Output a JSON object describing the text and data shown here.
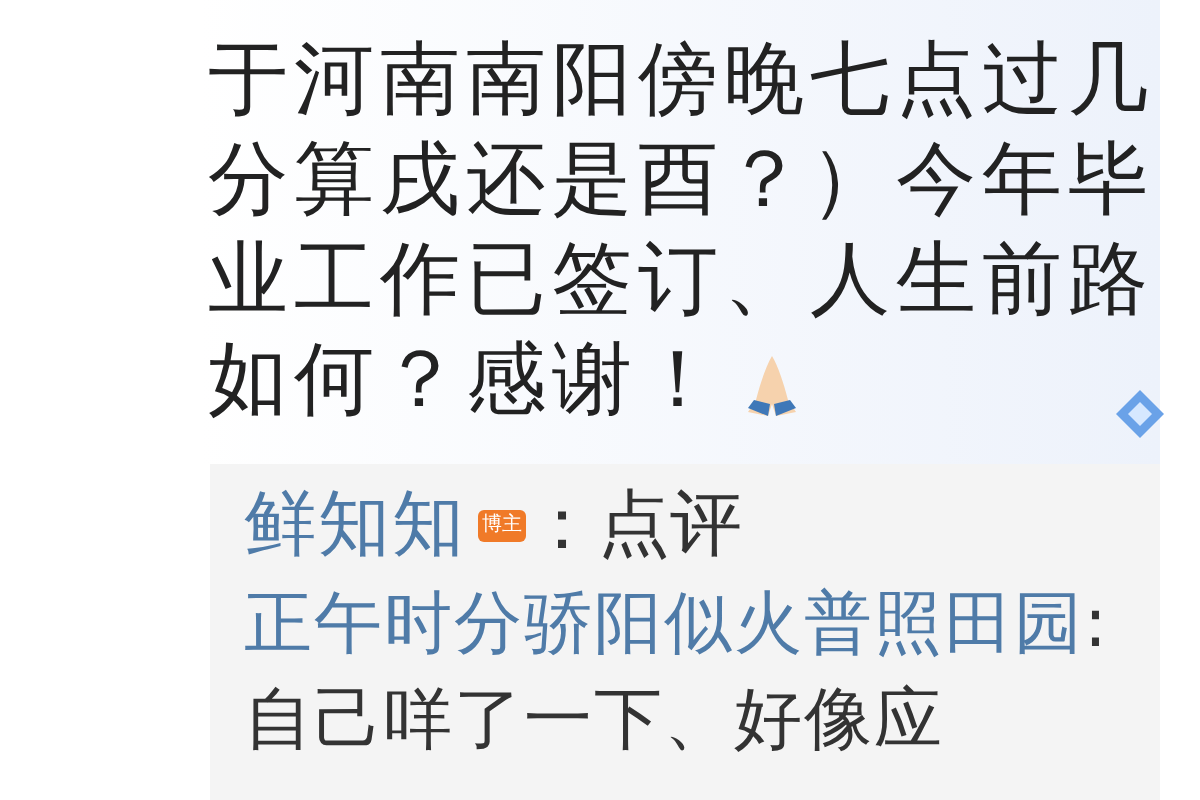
{
  "post": {
    "lines": [
      "于河南南阳傍晚七点过几",
      "分算戌还是酉？）今年毕",
      "业工作已签订、人生前路",
      "如何？感谢！"
    ]
  },
  "comment": {
    "author": "鲜知知",
    "badge": "博主",
    "action": "：点评",
    "reply_author": "正午时分骄阳似火普照田园",
    "separator": ":",
    "text": " 自己咩了一下、好像应"
  }
}
